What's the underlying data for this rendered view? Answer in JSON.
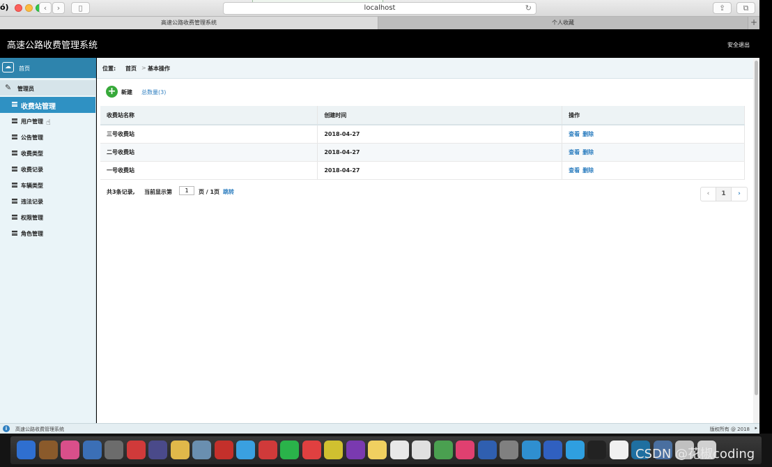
{
  "browser": {
    "url": "localhost",
    "edge_text": "ó)",
    "tabs": [
      {
        "label": "高速公路收费管理系统"
      },
      {
        "label": "个人收藏"
      }
    ],
    "add_tab_glyph": "+"
  },
  "header": {
    "title": "高速公路收费管理系统",
    "logout": "安全退出"
  },
  "sidebar": {
    "home": "首页",
    "section": "管理员",
    "items": [
      {
        "label": "收费站管理",
        "active": true
      },
      {
        "label": "用户管理"
      },
      {
        "label": "公告管理"
      },
      {
        "label": "收费类型"
      },
      {
        "label": "收费记录"
      },
      {
        "label": "车辆类型"
      },
      {
        "label": "违法记录"
      },
      {
        "label": "权限管理"
      },
      {
        "label": "角色管理"
      }
    ]
  },
  "breadcrumb": {
    "prefix": "位置:",
    "home": "首页",
    "separator": ">",
    "current": "基本操作"
  },
  "toolbar": {
    "new_label": "新建",
    "total": "总数量(3)"
  },
  "table": {
    "columns": [
      "收费站名称",
      "创建时间",
      "操作"
    ],
    "rows": [
      {
        "name": "三号收费站",
        "created": "2018-04-27",
        "view": "查看",
        "delete": "删除"
      },
      {
        "name": "二号收费站",
        "created": "2018-04-27",
        "view": "查看",
        "delete": "删除"
      },
      {
        "name": "一号收费站",
        "created": "2018-04-27",
        "view": "查看",
        "delete": "删除"
      }
    ]
  },
  "pagination": {
    "total_text": "共3条记录,",
    "current_label": "当前显示第",
    "page_value": "1",
    "pages_text": "页 / 1页",
    "jump": "跳转",
    "prev": "‹",
    "current": "1",
    "next": "›"
  },
  "status": {
    "text": "高速公路收费管理系统",
    "copyright": "版权所有 @ 2018"
  },
  "watermark": "CSDN @花椒coding",
  "colors": {
    "sidebar_active": "#2f91c3",
    "link": "#2f7fc0",
    "new_icon": "#37a93a"
  }
}
